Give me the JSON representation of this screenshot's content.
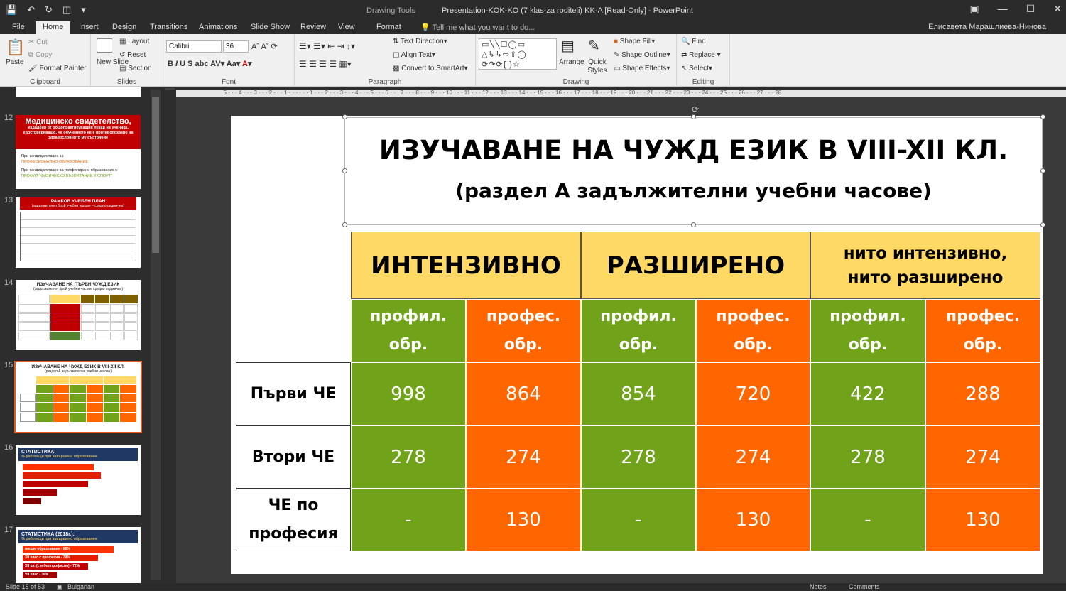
{
  "titlebar": {
    "context_tab": "Drawing Tools",
    "title": "Presentation-KOK-KO (7 klas-za roditeli) KK-A [Read-Only] - PowerPoint"
  },
  "tabs": {
    "items": [
      "File",
      "Home",
      "Insert",
      "Design",
      "Transitions",
      "Animations",
      "Slide Show",
      "Review",
      "View",
      "Format"
    ],
    "tell_me": "Tell me what you want to do...",
    "user": "Елисавета Марашлиева-Нинова"
  },
  "ribbon": {
    "clipboard": {
      "label": "Clipboard",
      "paste": "Paste",
      "cut": "Cut",
      "copy": "Copy",
      "format_painter": "Format Painter"
    },
    "slides": {
      "label": "Slides",
      "new_slide": "New Slide",
      "layout": "Layout",
      "reset": "Reset",
      "section": "Section"
    },
    "font": {
      "label": "Font",
      "family": "Calibri",
      "size": "36"
    },
    "paragraph": {
      "label": "Paragraph",
      "text_direction": "Text Direction",
      "align_text": "Align Text",
      "convert": "Convert to SmartArt"
    },
    "drawing": {
      "label": "Drawing",
      "arrange": "Arrange",
      "quick_styles": "Quick Styles",
      "shape_fill": "Shape Fill",
      "shape_outline": "Shape Outline",
      "shape_effects": "Shape Effects"
    },
    "editing": {
      "label": "Editing",
      "find": "Find",
      "replace": "Replace",
      "select": "Select"
    }
  },
  "thumbnails": [
    {
      "num": "12",
      "title": "Медицинско свидетелство,",
      "sub": "издадено от общопрактикуващия лекар на ученика, удостоверяващо, че обучението не е противопоказно на здравословното му състояние",
      "b1": "При кандидатстване за",
      "b1a": "ПРОФЕСИОНАЛНО ОБРАЗОВАНИЕ",
      "b2": "При кандидатстване за профилирано образование с",
      "b2a": "ПРОФИЛ \"ФИЗИЧЕСКО ВЪЗПИТАНИЕ И СПОРТ\""
    },
    {
      "num": "13",
      "title": "РАМКОВ УЧЕБЕН ПЛАН",
      "sub": "(задължителен брой учебни часове – средно седмично)"
    },
    {
      "num": "14",
      "title": "ИЗУЧАВАНЕ НА ПЪРВИ ЧУЖД ЕЗИК",
      "sub": "(задължителен брой учебни часове средно седмично)"
    },
    {
      "num": "15",
      "title": "ИЗУЧАВАНЕ НА ЧУЖД ЕЗИК В VIII-XII КЛ.",
      "sub": "(раздел А задължителни учебни часове)"
    },
    {
      "num": "16",
      "title": "СТАТИСТИКА:",
      "sub": "% работещи при завършено образование"
    },
    {
      "num": "17",
      "title": "СТАТИСТИКА (2018г.):",
      "sub": "% работещи при завършено образование",
      "items": [
        "висше образование - 86%",
        "XII клас с професия - 79%",
        "XII кл. (с и без професия) - 72%",
        "VII клас - 36%"
      ]
    }
  ],
  "slide": {
    "title": "ИЗУЧАВАНЕ НА ЧУЖД ЕЗИК В VIII-XII КЛ.",
    "subtitle": "(раздел А задължителни учебни часове)",
    "groups": [
      "ИНТЕНЗИВНО",
      "РАЗШИРЕНО",
      "нито интензивно, нито разширено"
    ],
    "subheads": [
      "профил. обр.",
      "профес. обр.",
      "профил. обр.",
      "профес. обр.",
      "профил. обр.",
      "профес. обр."
    ],
    "rows": [
      {
        "label": "Първи ЧЕ",
        "values": [
          "998",
          "864",
          "854",
          "720",
          "422",
          "288"
        ]
      },
      {
        "label": "Втори ЧЕ",
        "values": [
          "278",
          "274",
          "278",
          "274",
          "278",
          "274"
        ]
      },
      {
        "label": "ЧЕ по професия",
        "values": [
          "-",
          "130",
          "-",
          "130",
          "-",
          "130"
        ]
      }
    ]
  },
  "status": {
    "slide": "Slide 15 of 53",
    "language": "Bulgarian",
    "notes": "Notes",
    "comments": "Comments"
  }
}
